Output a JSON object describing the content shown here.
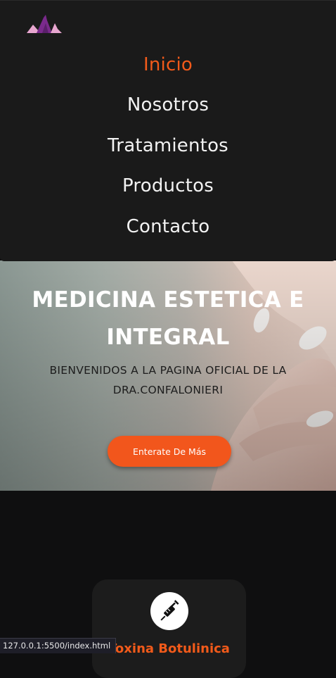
{
  "nav": {
    "items": [
      {
        "label": "Inicio",
        "active": true
      },
      {
        "label": "Nosotros",
        "active": false
      },
      {
        "label": "Tratamientos",
        "active": false
      },
      {
        "label": "Productos",
        "active": false
      },
      {
        "label": "Contacto",
        "active": false
      }
    ]
  },
  "hero": {
    "title": "MEDICINA ESTETICA E INTEGRAL",
    "subtitle": "BIENVENIDOS A LA PAGINA OFICIAL DE LA DRA.CONFALONIERI",
    "cta_label": "Enterate De Más"
  },
  "services": {
    "items": [
      {
        "title": "Toxina Botulinica",
        "icon": "syringe-icon"
      }
    ]
  },
  "status_bar": {
    "url": "127.0.0.1:5500/index.html"
  },
  "colors": {
    "accent": "#f25a1a",
    "nav_bg": "#1a1a1a",
    "page_bg": "#0f0f10",
    "card_bg": "#1c1c1c",
    "logo_primary": "#7a2a8c",
    "logo_secondary": "#e7a6cf"
  }
}
